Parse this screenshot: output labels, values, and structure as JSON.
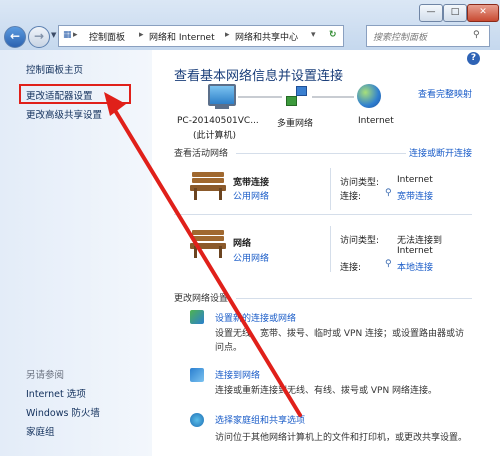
{
  "window": {
    "address_parts": [
      "控制面板",
      "网络和 Internet",
      "网络和共享中心"
    ],
    "search_placeholder": "搜索控制面板",
    "help_glyph": "?"
  },
  "sidebar": {
    "home": "控制面板主页",
    "change_adapter": "更改适配器设置",
    "change_sharing": "更改高级共享设置",
    "see_also_title": "另请参阅",
    "see_also": [
      "Internet 选项",
      "Windows 防火墙",
      "家庭组"
    ]
  },
  "main": {
    "title": "查看基本网络信息并设置连接",
    "full_map_link": "查看完整映射",
    "map": {
      "pc_name": "PC-20140501VC...",
      "pc_sub": "(此计算机)",
      "multi_network": "多重网络",
      "internet": "Internet"
    },
    "active_title": "查看活动网络",
    "connect_link": "连接或断开连接",
    "networks": [
      {
        "name": "宽带连接",
        "type": "公用网络",
        "access_label": "访问类型:",
        "access_value": "Internet",
        "conn_label": "连接:",
        "conn_value": "宽带连接"
      },
      {
        "name": "网络",
        "type": "公用网络",
        "access_label": "访问类型:",
        "access_value_1": "无法连接到",
        "access_value_2": "Internet",
        "conn_label": "连接:",
        "conn_value": "本地连接"
      }
    ],
    "change_title": "更改网络设置",
    "tasks": [
      {
        "link": "设置新的连接或网络",
        "desc_1": "设置无线、宽带、拨号、临时或 VPN 连接；或设置路由器或访",
        "desc_2": "问点。"
      },
      {
        "link": "连接到网络",
        "desc_1": "连接或重新连接到无线、有线、拨号或 VPN 网络连接。"
      },
      {
        "link": "选择家庭组和共享选项",
        "desc_1": "访问位于其他网络计算机上的文件和打印机，或更改共享设置。"
      }
    ]
  },
  "colors": {
    "annotation_red": "#e0201a",
    "link_blue": "#1a5cc8"
  }
}
